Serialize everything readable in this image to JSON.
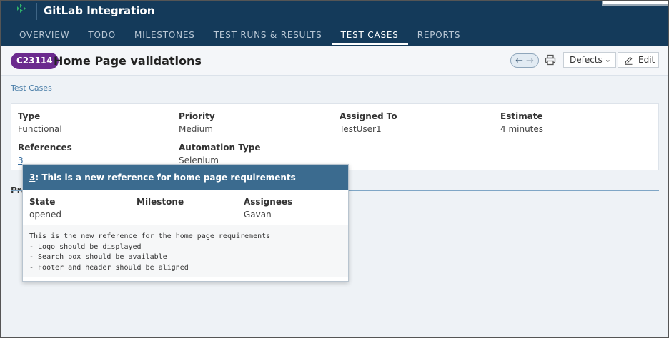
{
  "app": {
    "title": "GitLab Integration",
    "accent_color": "#143a5a",
    "brand_color": "#2fb36b"
  },
  "nav": {
    "tabs": [
      {
        "label": "OVERVIEW"
      },
      {
        "label": "TODO"
      },
      {
        "label": "MILESTONES"
      },
      {
        "label": "TEST RUNS & RESULTS"
      },
      {
        "label": "TEST CASES",
        "active": true
      },
      {
        "label": "REPORTS"
      }
    ]
  },
  "case": {
    "id": "C23114",
    "title": "Home Page validations",
    "badge_color": "#6b2a8e"
  },
  "toolbar": {
    "prev_icon": "arrow-left-icon",
    "next_icon": "arrow-right-icon",
    "print_icon": "printer-icon",
    "defects_label": "Defects",
    "edit_label": "Edit"
  },
  "breadcrumb": "Test Cases",
  "details": {
    "type_label": "Type",
    "type_value": "Functional",
    "priority_label": "Priority",
    "priority_value": "Medium",
    "assigned_label": "Assigned To",
    "assigned_value": "TestUser1",
    "estimate_label": "Estimate",
    "estimate_value": "4 minutes",
    "references_label": "References",
    "references_value": "3",
    "automation_label": "Automation Type",
    "automation_value": "Selenium"
  },
  "section": {
    "label_visible": "Pre"
  },
  "popover": {
    "ref_number": "3",
    "title_rest": ": This is a new reference for home page requirements",
    "state_label": "State",
    "state_value": "opened",
    "milestone_label": "Milestone",
    "milestone_value": "-",
    "assignees_label": "Assignees",
    "assignees_value": "Gavan",
    "description": [
      "This is the new reference for the home page requirements",
      "- Logo should be displayed",
      "- Search box should be available",
      "- Footer and header should be aligned"
    ]
  }
}
